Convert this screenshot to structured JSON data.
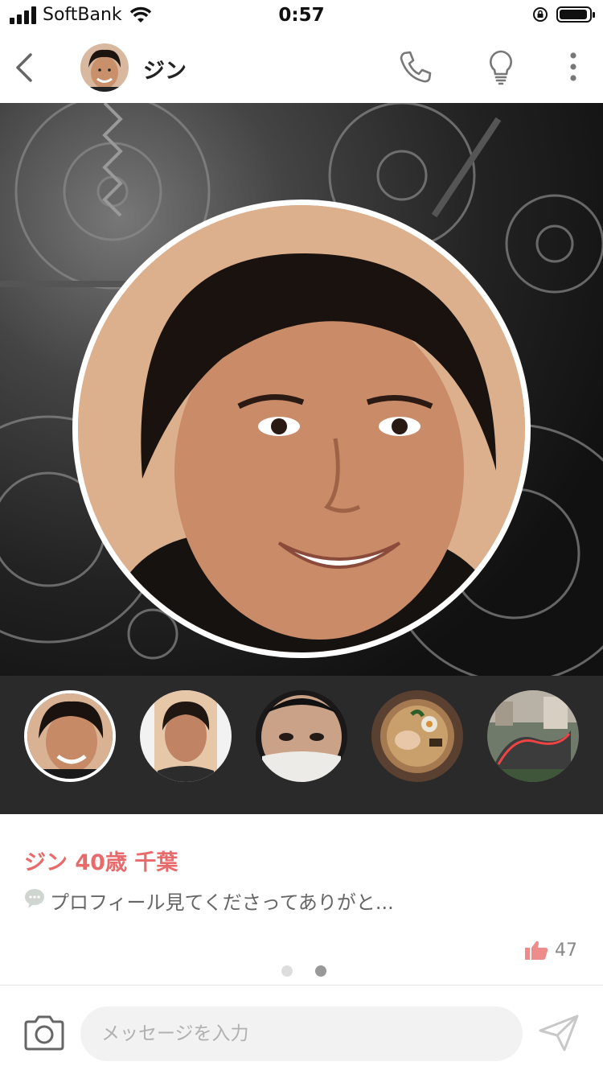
{
  "status_bar": {
    "carrier": "SoftBank",
    "time": "0:57"
  },
  "header": {
    "name": "ジン"
  },
  "profile": {
    "title": "ジン 40歳 千葉",
    "message": "プロフィール見てくださってありがと...",
    "likes": "47"
  },
  "thumbnails": [
    {
      "label": "photo-smiling"
    },
    {
      "label": "photo-selfie"
    },
    {
      "label": "photo-mask"
    },
    {
      "label": "photo-ramen"
    },
    {
      "label": "photo-city-circuit"
    }
  ],
  "composer": {
    "placeholder": "メッセージを入力"
  },
  "colors": {
    "accent": "#e86b6b",
    "strip_bg": "#2a2a2a"
  },
  "icons": [
    "back-icon",
    "phone-icon",
    "lightbulb-icon",
    "more-icon",
    "chat-bubble-icon",
    "thumbs-up-icon",
    "camera-icon",
    "send-icon"
  ]
}
